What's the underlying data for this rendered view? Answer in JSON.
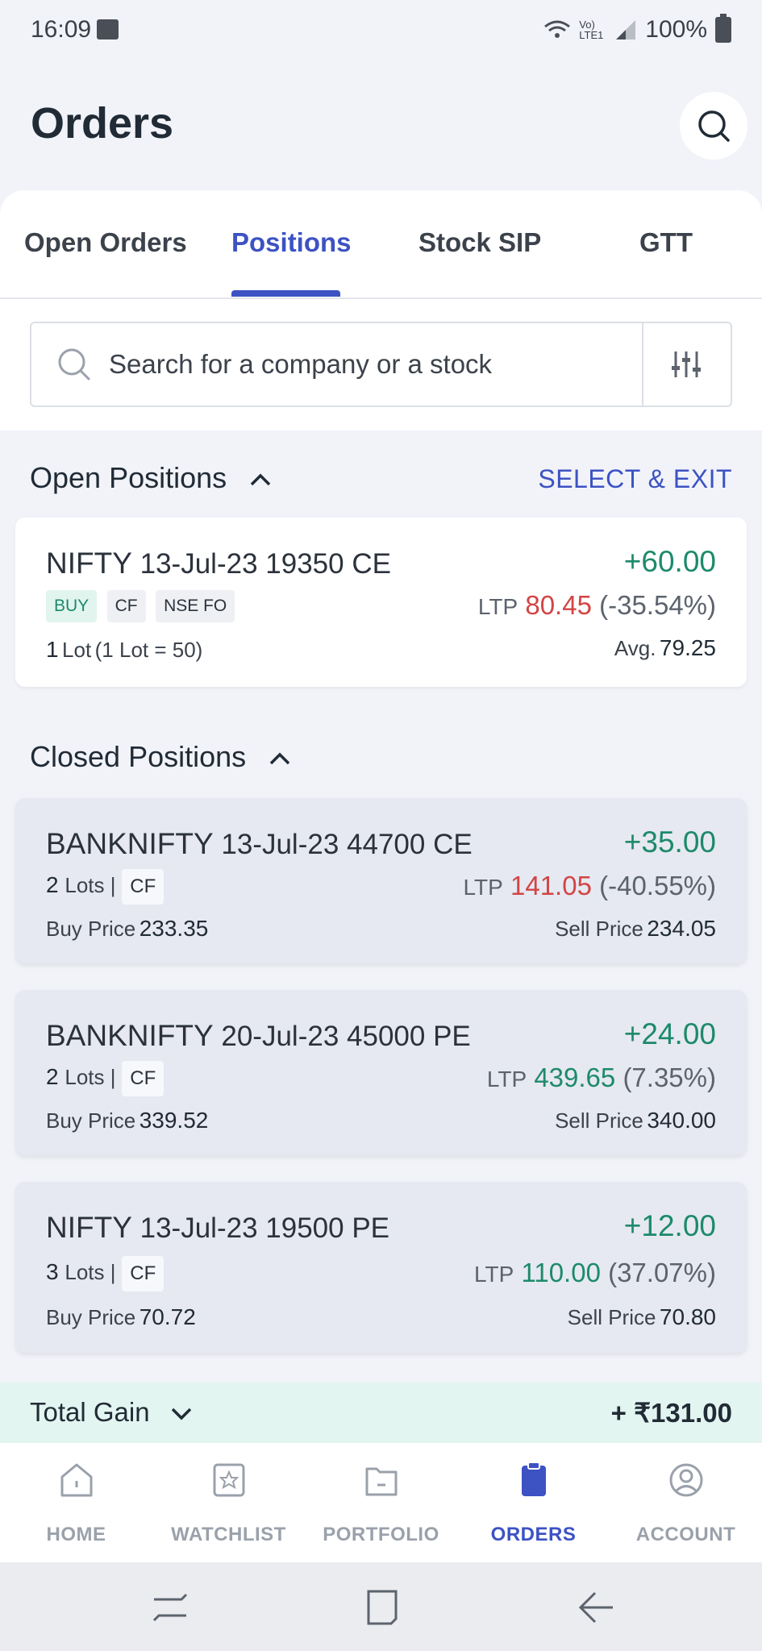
{
  "status_bar": {
    "time": "16:09",
    "network": "Vo) LTE1",
    "battery": "100%"
  },
  "header": {
    "title": "Orders"
  },
  "tabs": [
    {
      "label": "Open Orders"
    },
    {
      "label": "Positions"
    },
    {
      "label": "Stock SIP"
    },
    {
      "label": "GTT"
    }
  ],
  "search": {
    "placeholder": "Search for a company or a stock"
  },
  "open_positions": {
    "title": "Open Positions",
    "action": "SELECT & EXIT",
    "items": [
      {
        "symbol": "NIFTY",
        "contract": "13-Jul-23 19350 CE",
        "pnl": "+60.00",
        "tags": [
          "BUY",
          "CF",
          "NSE FO"
        ],
        "ltp_label": "LTP",
        "ltp": "80.45",
        "change": "(-35.54%)",
        "lots_count": "1",
        "lots_label": "Lot",
        "lot_size": "(1 Lot = 50)",
        "avg_label": "Avg.",
        "avg": "79.25"
      }
    ]
  },
  "closed_positions": {
    "title": "Closed Positions",
    "items": [
      {
        "symbol": "BANKNIFTY",
        "contract": "13-Jul-23 44700 CE",
        "pnl": "+35.00",
        "lots_count": "2",
        "lots_label": "Lots |",
        "tag": "CF",
        "ltp_label": "LTP",
        "ltp": "141.05",
        "change": "(-40.55%)",
        "buy_label": "Buy Price",
        "buy": "233.35",
        "sell_label": "Sell Price",
        "sell": "234.05"
      },
      {
        "symbol": "BANKNIFTY",
        "contract": "20-Jul-23 45000 PE",
        "pnl": "+24.00",
        "lots_count": "2",
        "lots_label": "Lots |",
        "tag": "CF",
        "ltp_label": "LTP",
        "ltp": "439.65",
        "change": "(7.35%)",
        "buy_label": "Buy Price",
        "buy": "339.52",
        "sell_label": "Sell Price",
        "sell": "340.00"
      },
      {
        "symbol": "NIFTY",
        "contract": "13-Jul-23 19500 PE",
        "pnl": "+12.00",
        "lots_count": "3",
        "lots_label": "Lots |",
        "tag": "CF",
        "ltp_label": "LTP",
        "ltp": "110.00",
        "change": "(37.07%)",
        "buy_label": "Buy Price",
        "buy": "70.72",
        "sell_label": "Sell Price",
        "sell": "70.80"
      }
    ]
  },
  "total": {
    "label": "Total Gain",
    "value": "+ ₹131.00"
  },
  "bottom_nav": [
    {
      "label": "HOME",
      "icon": "home-icon"
    },
    {
      "label": "WATCHLIST",
      "icon": "star-icon"
    },
    {
      "label": "PORTFOLIO",
      "icon": "folder-icon"
    },
    {
      "label": "ORDERS",
      "icon": "clipboard-icon"
    },
    {
      "label": "ACCOUNT",
      "icon": "user-circle-icon"
    }
  ],
  "colors": {
    "accent": "#3d52c3",
    "profit": "#1d8a6b",
    "loss": "#d24545"
  }
}
